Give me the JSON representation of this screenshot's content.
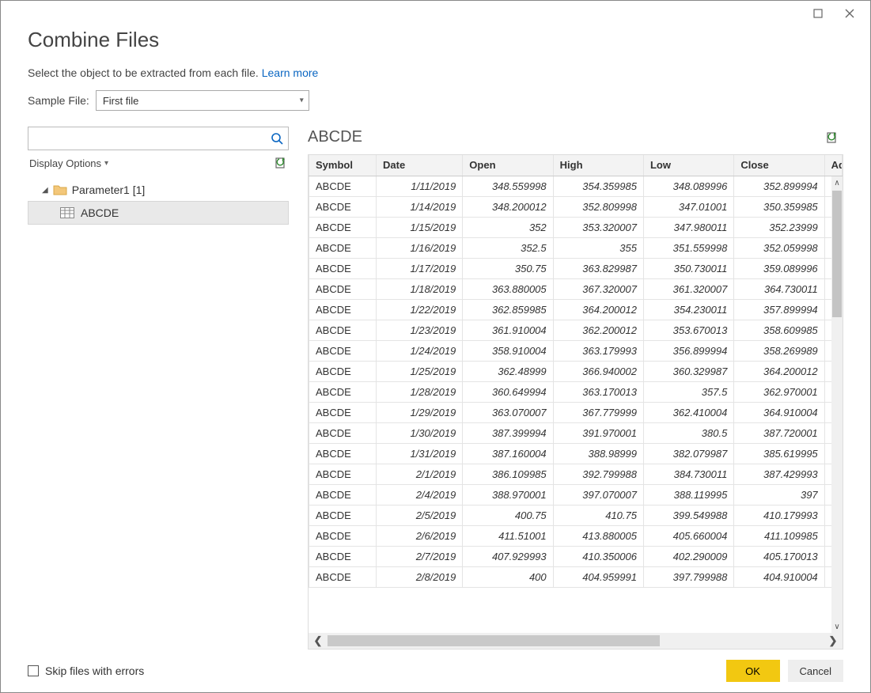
{
  "window": {
    "title": "Combine Files",
    "subtitle_text": "Select the object to be extracted from each file. ",
    "learn_more": "Learn more"
  },
  "sample_file": {
    "label": "Sample File:",
    "value": "First file"
  },
  "search": {
    "placeholder": ""
  },
  "display_options_label": "Display Options",
  "tree": {
    "folder_label": "Parameter1 [1]",
    "item_label": "ABCDE"
  },
  "preview": {
    "title": "ABCDE"
  },
  "table": {
    "columns": [
      "Symbol",
      "Date",
      "Open",
      "High",
      "Low",
      "Close",
      "Ad"
    ],
    "rows": [
      {
        "Symbol": "ABCDE",
        "Date": "1/11/2019",
        "Open": "348.559998",
        "High": "354.359985",
        "Low": "348.089996",
        "Close": "352.899994"
      },
      {
        "Symbol": "ABCDE",
        "Date": "1/14/2019",
        "Open": "348.200012",
        "High": "352.809998",
        "Low": "347.01001",
        "Close": "350.359985"
      },
      {
        "Symbol": "ABCDE",
        "Date": "1/15/2019",
        "Open": "352",
        "High": "353.320007",
        "Low": "347.980011",
        "Close": "352.23999"
      },
      {
        "Symbol": "ABCDE",
        "Date": "1/16/2019",
        "Open": "352.5",
        "High": "355",
        "Low": "351.559998",
        "Close": "352.059998"
      },
      {
        "Symbol": "ABCDE",
        "Date": "1/17/2019",
        "Open": "350.75",
        "High": "363.829987",
        "Low": "350.730011",
        "Close": "359.089996"
      },
      {
        "Symbol": "ABCDE",
        "Date": "1/18/2019",
        "Open": "363.880005",
        "High": "367.320007",
        "Low": "361.320007",
        "Close": "364.730011"
      },
      {
        "Symbol": "ABCDE",
        "Date": "1/22/2019",
        "Open": "362.859985",
        "High": "364.200012",
        "Low": "354.230011",
        "Close": "357.899994"
      },
      {
        "Symbol": "ABCDE",
        "Date": "1/23/2019",
        "Open": "361.910004",
        "High": "362.200012",
        "Low": "353.670013",
        "Close": "358.609985"
      },
      {
        "Symbol": "ABCDE",
        "Date": "1/24/2019",
        "Open": "358.910004",
        "High": "363.179993",
        "Low": "356.899994",
        "Close": "358.269989"
      },
      {
        "Symbol": "ABCDE",
        "Date": "1/25/2019",
        "Open": "362.48999",
        "High": "366.940002",
        "Low": "360.329987",
        "Close": "364.200012"
      },
      {
        "Symbol": "ABCDE",
        "Date": "1/28/2019",
        "Open": "360.649994",
        "High": "363.170013",
        "Low": "357.5",
        "Close": "362.970001"
      },
      {
        "Symbol": "ABCDE",
        "Date": "1/29/2019",
        "Open": "363.070007",
        "High": "367.779999",
        "Low": "362.410004",
        "Close": "364.910004"
      },
      {
        "Symbol": "ABCDE",
        "Date": "1/30/2019",
        "Open": "387.399994",
        "High": "391.970001",
        "Low": "380.5",
        "Close": "387.720001"
      },
      {
        "Symbol": "ABCDE",
        "Date": "1/31/2019",
        "Open": "387.160004",
        "High": "388.98999",
        "Low": "382.079987",
        "Close": "385.619995"
      },
      {
        "Symbol": "ABCDE",
        "Date": "2/1/2019",
        "Open": "386.109985",
        "High": "392.799988",
        "Low": "384.730011",
        "Close": "387.429993"
      },
      {
        "Symbol": "ABCDE",
        "Date": "2/4/2019",
        "Open": "388.970001",
        "High": "397.070007",
        "Low": "388.119995",
        "Close": "397"
      },
      {
        "Symbol": "ABCDE",
        "Date": "2/5/2019",
        "Open": "400.75",
        "High": "410.75",
        "Low": "399.549988",
        "Close": "410.179993"
      },
      {
        "Symbol": "ABCDE",
        "Date": "2/6/2019",
        "Open": "411.51001",
        "High": "413.880005",
        "Low": "405.660004",
        "Close": "411.109985"
      },
      {
        "Symbol": "ABCDE",
        "Date": "2/7/2019",
        "Open": "407.929993",
        "High": "410.350006",
        "Low": "402.290009",
        "Close": "405.170013"
      },
      {
        "Symbol": "ABCDE",
        "Date": "2/8/2019",
        "Open": "400",
        "High": "404.959991",
        "Low": "397.799988",
        "Close": "404.910004"
      }
    ]
  },
  "footer": {
    "skip_label": "Skip files with errors",
    "ok_label": "OK",
    "cancel_label": "Cancel"
  }
}
